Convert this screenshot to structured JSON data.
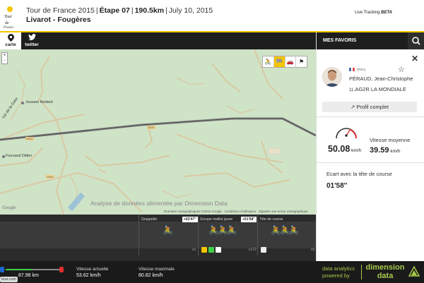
{
  "header": {
    "tour": "Tour de France 2015",
    "stage": "Étape 07",
    "distance": "190.5km",
    "date": "July 10, 2015",
    "route": "Livarot - Fougères",
    "live_label": "Live Tracking",
    "live_badge": "BETA"
  },
  "tabs": [
    {
      "label": "carte",
      "icon": "map-pin-icon"
    },
    {
      "label": "twitter",
      "icon": "twitter-icon"
    }
  ],
  "map": {
    "zoom_in": "+",
    "zoom_out": "-",
    "tools": [
      "cyclist-icon",
      "yellow-jersey-icon",
      "car-icon",
      "finish-icon"
    ],
    "places": [
      "Jousset Norbert",
      "Foucaud Didier",
      "rue de la Gare",
      "D920"
    ],
    "watermark": "Analyse de données alimentée par Dimension Data",
    "attribution": [
      "Données cartographiques ©2015 Google",
      "Conditions d'utilisation",
      "Signaler une erreur cartographique"
    ],
    "google": "Google"
  },
  "race": {
    "groups": [
      {
        "label": "Gruppetto",
        "gap": "+02'47\""
      },
      {
        "label": "Groupe maillot jaune",
        "gap": "+01'58\""
      },
      {
        "label": "Tête de course",
        "gap": ""
      }
    ],
    "counts": [
      "x1",
      "x172",
      "x5"
    ]
  },
  "stats": {
    "distance": "87.98 km",
    "progress": 0.46,
    "current_speed_label": "Vitesse actuelle",
    "current_speed": "53.62 km/h",
    "max_speed_label": "Vitesse maximale",
    "max_speed": "80.82 km/h",
    "badge": "tour.com"
  },
  "favorites": {
    "title": "MES FAVORIS",
    "rider": {
      "country": "(FRA)",
      "name": "PÉRAUD, Jean-Christophe",
      "team_num": "11",
      "team": "AG2R LA MONDIALE"
    },
    "profile_button": "Profil complet",
    "speed_value": "50.08",
    "speed_unit": "km/h",
    "avg_label": "Vitesse moyenne",
    "avg_value": "39.59",
    "avg_unit": "km/h",
    "gap_label": "Ecart avec la tête de course",
    "gap_value": "01'58''"
  },
  "footer": {
    "line1": "data analytics",
    "line2": "powered by",
    "brand1": "dimension",
    "brand2": "data"
  },
  "colors": {
    "accent": "#f5c400",
    "dd_green": "#a7c94a",
    "progress": "#3fd04a"
  }
}
